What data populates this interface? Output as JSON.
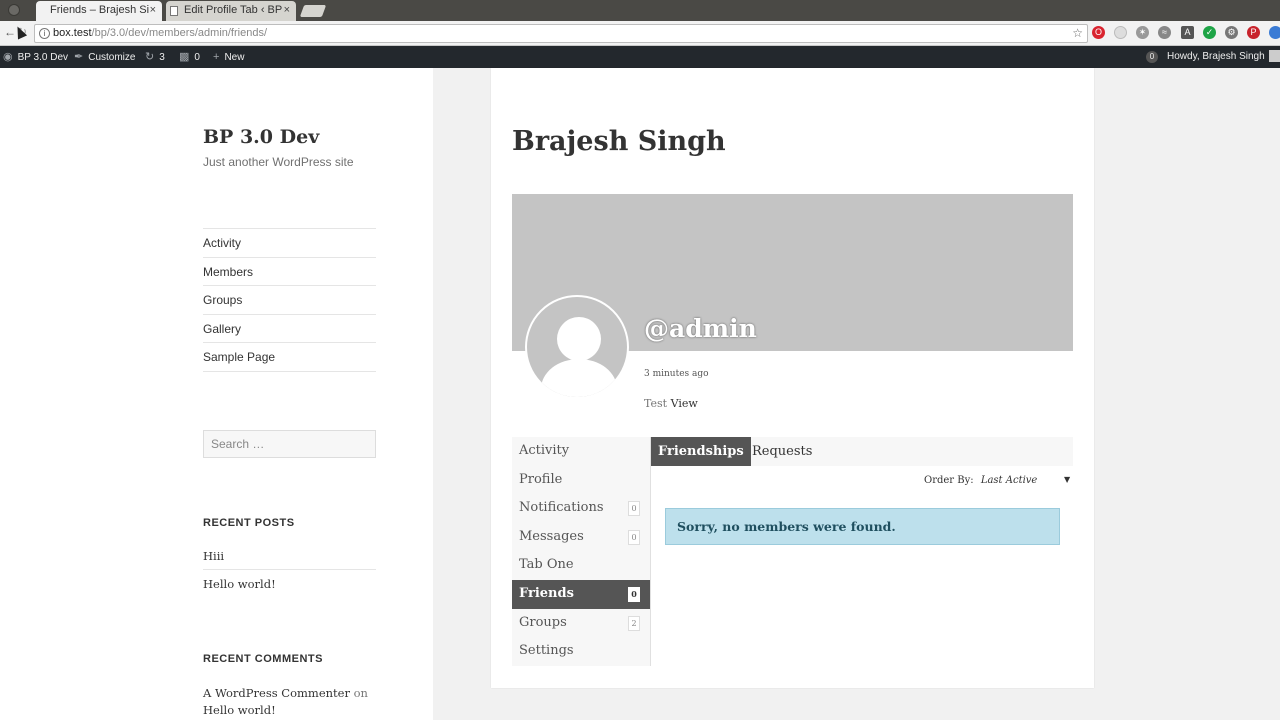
{
  "browser": {
    "tabs": [
      {
        "title": "Friends – Brajesh Si",
        "active": true
      },
      {
        "title": "Edit Profile Tab ‹ BP",
        "active": false
      }
    ],
    "url_host": "box.test",
    "url_path": "/bp/3.0/dev/members/admin/friends/",
    "close_glyph": "×"
  },
  "adminbar": {
    "site_name": "BP 3.0 Dev",
    "customize": "Customize",
    "updates_count": "3",
    "comments_count": "0",
    "new_label": "New",
    "notifications_count": "0",
    "howdy": "Howdy, Brajesh Singh"
  },
  "sidebar": {
    "site_title": "BP 3.0 Dev",
    "site_description": "Just another WordPress site",
    "menu": [
      "Activity",
      "Members",
      "Groups",
      "Gallery",
      "Sample Page"
    ],
    "search_placeholder": "Search …",
    "recent_posts_title": "RECENT POSTS",
    "recent_posts": [
      "Hiii",
      "Hello world!"
    ],
    "recent_comments_title": "RECENT COMMENTS",
    "recent_comment": {
      "author": "A WordPress Commenter",
      "on": "on",
      "post": "Hello world!"
    }
  },
  "profile": {
    "page_title": "Brajesh Singh",
    "handle": "@admin",
    "last_active": "3 minutes ago",
    "field_label": "Test",
    "field_value": "View",
    "nav": [
      {
        "label": "Activity",
        "count": null,
        "active": false
      },
      {
        "label": "Profile",
        "count": null,
        "active": false
      },
      {
        "label": "Notifications",
        "count": "0",
        "active": false
      },
      {
        "label": "Messages",
        "count": "0",
        "active": false
      },
      {
        "label": "Tab One",
        "count": null,
        "active": false
      },
      {
        "label": "Friends",
        "count": "0",
        "active": true
      },
      {
        "label": "Groups",
        "count": "2",
        "active": false
      },
      {
        "label": "Settings",
        "count": null,
        "active": false
      }
    ],
    "subnav": [
      "Friendships",
      "Requests"
    ],
    "order_by_label": "Order By:",
    "order_by_value": "Last Active",
    "notice": "Sorry, no members were found."
  }
}
